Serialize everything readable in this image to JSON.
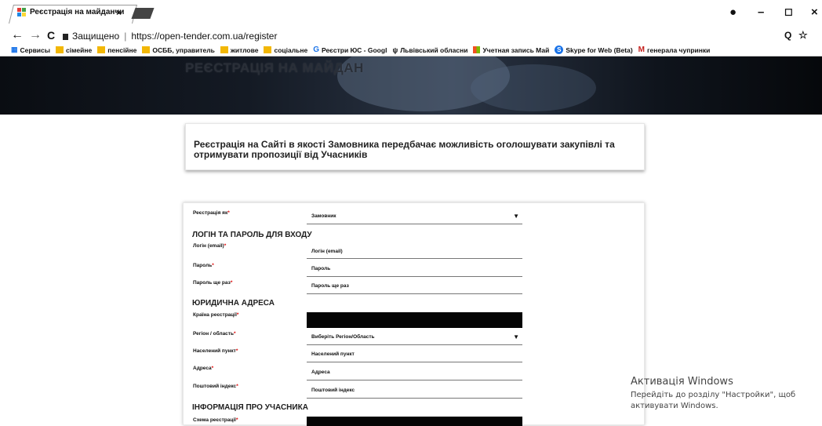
{
  "browser": {
    "tab_title": "Реєстрація на майданчи",
    "tab_close": "×",
    "address_secure": "Защищено",
    "address_url": "https://open-tender.com.ua/register",
    "window_controls": {
      "account": "●",
      "minimize": "–",
      "restore": "◻",
      "close": "×"
    },
    "nav": {
      "back": "←",
      "forward": "→",
      "reload": "C"
    },
    "toolbar_right": {
      "zoom": "Q",
      "star": "☆"
    },
    "bookmarks": [
      {
        "label": "Сервисы",
        "icon": "apps-icon"
      },
      {
        "label": "сімейне",
        "icon": "folder-icon"
      },
      {
        "label": "пенсійне",
        "icon": "folder-icon"
      },
      {
        "label": "ОСББ, управитель",
        "icon": "folder-icon"
      },
      {
        "label": "житлове",
        "icon": "folder-icon"
      },
      {
        "label": "соціальне",
        "icon": "folder-icon"
      },
      {
        "label": "Реєстри ЮС - Googl",
        "icon": "google-icon"
      },
      {
        "label": "Львівський обласни",
        "icon": "trident-icon"
      },
      {
        "label": "Учетная запись Май",
        "icon": "microsoft-icon"
      },
      {
        "label": "Skype for Web (Beta)",
        "icon": "skype-icon"
      },
      {
        "label": "генерала чупринки",
        "icon": "gmail-icon"
      }
    ]
  },
  "hero": {
    "title": "РЕЄСТРАЦІЯ НА МАЙДАН"
  },
  "info": {
    "text": "Реєстрація на Сайті в якості Замовника передбачає можливість оголошувати закупівлі та отримувати пропозиції від Учасників"
  },
  "form": {
    "register_as_label": "Реєстрація як",
    "register_as_value": "Замовник",
    "login_section": "ЛОГІН ТА ПАРОЛЬ ДЛЯ ВХОДУ",
    "login_label": "Логін (email)",
    "login_placeholder": "Логін (email)",
    "password_label": "Пароль",
    "password_placeholder": "Пароль",
    "password2_label": "Пароль ще раз",
    "password2_placeholder": "Пароль ще раз",
    "address_section": "ЮРИДИЧНА АДРЕСА",
    "country_label": "Країна реєстрації",
    "region_label": "Регіон / область",
    "region_value": "Виберіть Регіон/Область",
    "city_label": "Населений пункт",
    "city_placeholder": "Населений пункт",
    "street_label": "Адреса",
    "street_placeholder": "Адреса",
    "zip_label": "Поштовий індекс",
    "zip_placeholder": "Поштовий індекс",
    "participant_section": "ІНФОРМАЦІЯ ПРО УЧАСНИКА",
    "scheme_label": "Схема реєстрації",
    "required_mark": "*",
    "select_arrow": "▼"
  },
  "windows_activation": {
    "title": "Активація Windows",
    "text": "Перейдіть до розділу \"Настройки\", щоб активувати Windows."
  }
}
